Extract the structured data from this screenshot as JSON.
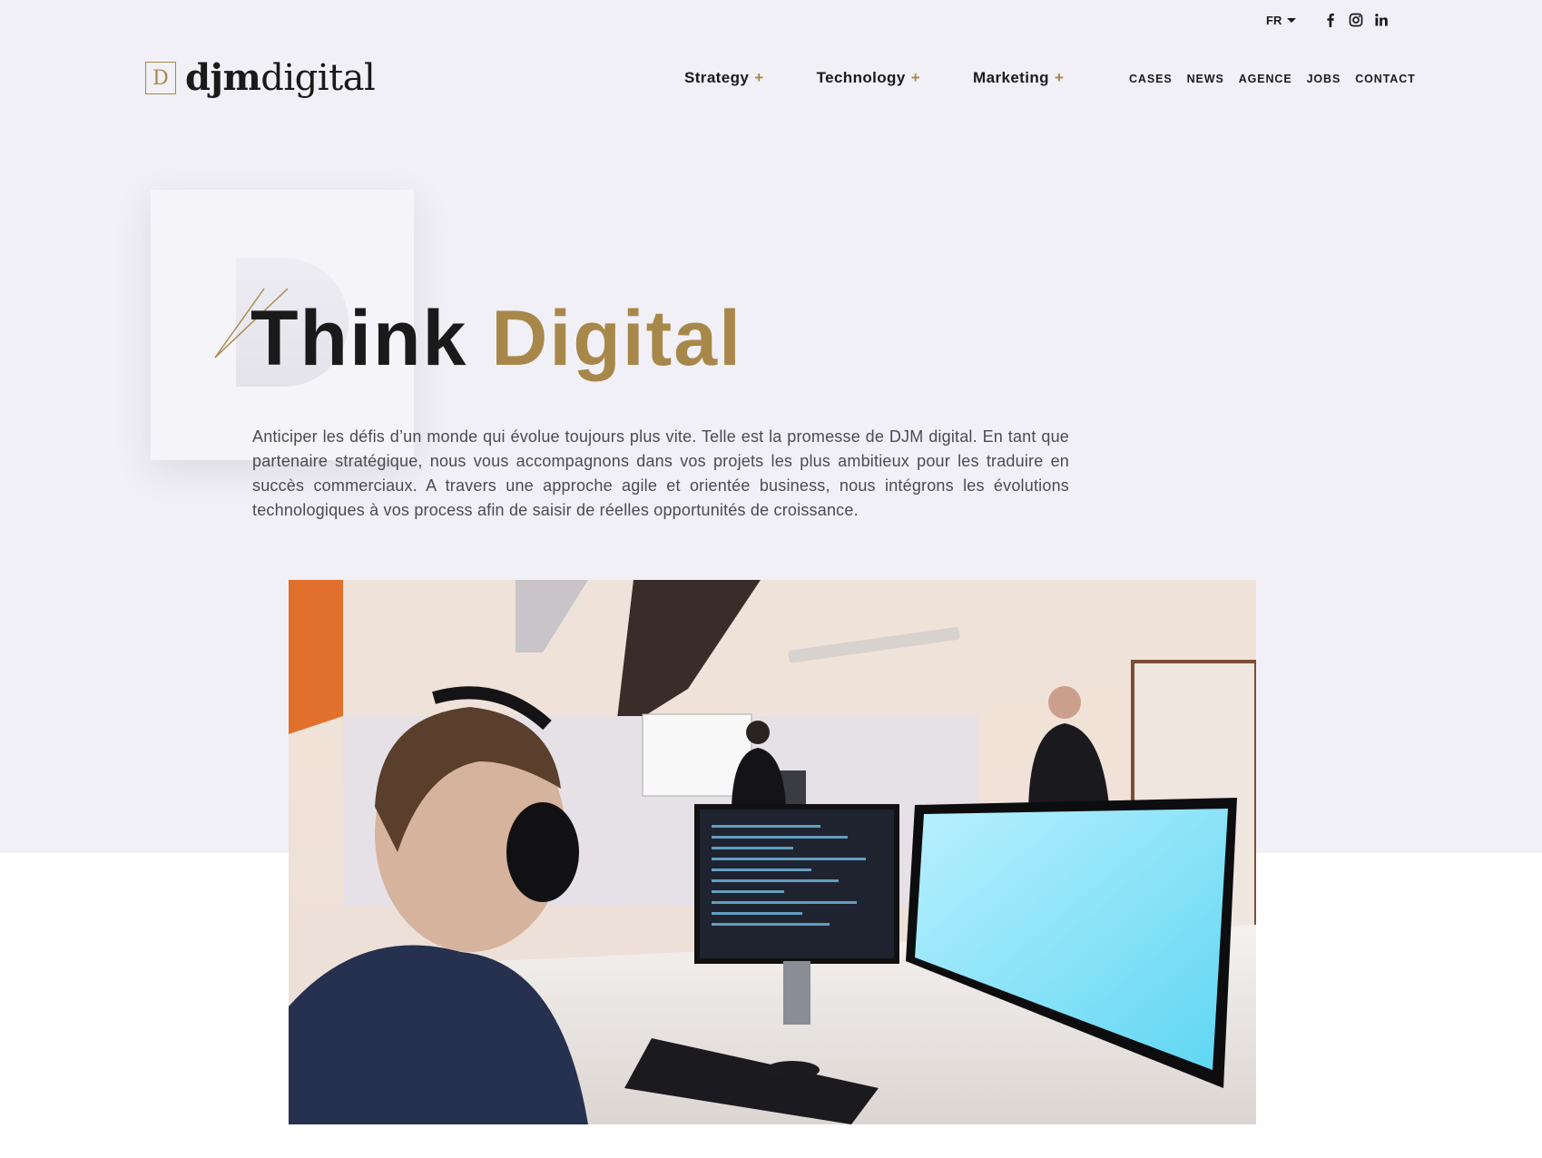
{
  "utility": {
    "lang": "FR",
    "socials": [
      {
        "icon": "facebook-icon",
        "label": "f"
      },
      {
        "icon": "instagram-icon",
        "label": ""
      },
      {
        "icon": "linkedin-icon",
        "label": "in"
      }
    ]
  },
  "brand": {
    "mark": "D",
    "name_bold": "djm",
    "name_light": "digital",
    "accent_color": "#a8884a",
    "text_color": "#1a1a1a",
    "background_color": "#f1f0f6"
  },
  "nav": {
    "main": [
      {
        "label": "Strategy",
        "icon": "plus"
      },
      {
        "label": "Technology",
        "icon": "plus"
      },
      {
        "label": "Marketing",
        "icon": "plus"
      }
    ],
    "secondary": [
      "CASES",
      "NEWS",
      "AGENCE",
      "JOBS",
      "CONTACT"
    ]
  },
  "hero": {
    "title_dark": "Think",
    "title_gold": "Digital",
    "paragraph": "Anticiper les défis d’un monde qui évolue toujours plus vite. Telle est la promesse de DJM digital. En tant que partenaire stratégique, nous vous accompagnons dans vos projets les plus ambitieux pour les traduire en succès commerciaux. A travers une approche agile et orientée business, nous intégrons les évolutions technologiques à vos process afin de saisir de réelles opportunités de croissance."
  },
  "media": {
    "icon": "office-team-photo"
  }
}
